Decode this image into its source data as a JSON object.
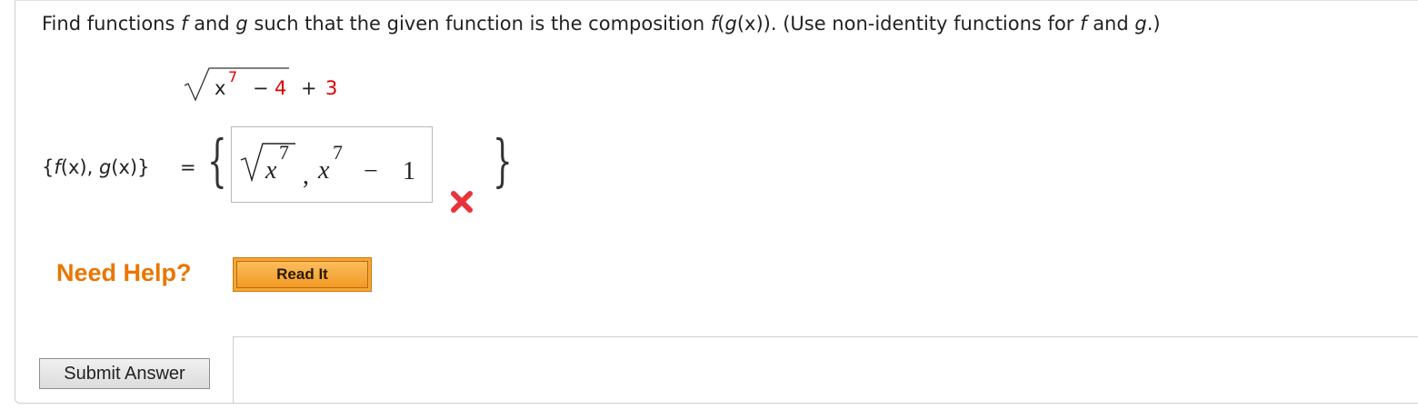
{
  "question": {
    "part1": "Find functions ",
    "f": "f",
    "part2": " and ",
    "g": "g",
    "part3": " such that the given function is the composition ",
    "comp_f": "f",
    "comp_open": "(",
    "comp_g": "g",
    "comp_rest": "(x)). (Use non-identity functions for ",
    "f2": "f",
    "part4": " and ",
    "g2": "g",
    "part5": ".)"
  },
  "given_function": {
    "var": "x",
    "exponent": "7",
    "minus": "−",
    "constant": "4",
    "plus": "+",
    "added": "3"
  },
  "answer": {
    "label_open": "{",
    "label_f": "f",
    "label_mid": "(x), ",
    "label_g": "g",
    "label_end": "(x)}",
    "equals": "=",
    "brace_left": "{",
    "brace_right": "}",
    "f_var": "x",
    "f_exp": "7",
    "comma": ",",
    "g_var": "x",
    "g_exp": "7",
    "g_minus": "−",
    "g_const": "1",
    "status": "incorrect",
    "status_color": "#e8333a"
  },
  "help": {
    "label": "Need Help?",
    "read_it": "Read It",
    "label_color": "#e87700"
  },
  "submit": {
    "label": "Submit Answer"
  }
}
